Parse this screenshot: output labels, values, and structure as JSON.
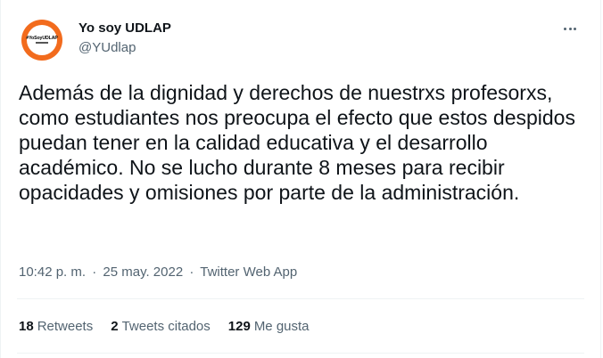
{
  "author": {
    "name": "Yo soy UDLAP",
    "handle": "@YUdlap",
    "avatar_text": "#YoSoyUDLAP",
    "avatar_color": "#f26b1d"
  },
  "tweet": {
    "text": "Además de la dignidad y derechos de nuestrxs profesorxs, como estudiantes nos preocupa el efecto que estos despidos puedan tener en la calidad educativa y el desarrollo académico. No se lucho durante 8 meses para recibir opacidades y omisiones por parte de la administración.",
    "time": "10:42 p. m.",
    "date": "25 may. 2022",
    "source": "Twitter Web App",
    "separator": "·"
  },
  "stats": {
    "retweets": {
      "count": "18",
      "label": "Retweets"
    },
    "quotes": {
      "count": "2",
      "label": "Tweets citados"
    },
    "likes": {
      "count": "129",
      "label": "Me gusta"
    }
  },
  "icons": {
    "more": "more-options-icon"
  },
  "colors": {
    "text": "#0f1419",
    "secondary": "#536471",
    "border": "#eff3f4"
  }
}
